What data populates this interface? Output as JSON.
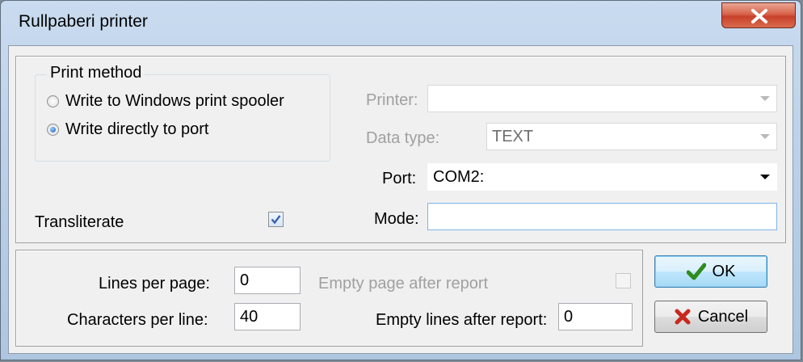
{
  "window": {
    "title": "Rullpaberi printer"
  },
  "print_method": {
    "legend": "Print method",
    "options": [
      {
        "label": "Write to Windows print spooler",
        "checked": false
      },
      {
        "label": "Write directly to port",
        "checked": true
      }
    ]
  },
  "printer": {
    "label": "Printer:",
    "value": ""
  },
  "data_type": {
    "label": "Data type:",
    "value": "TEXT"
  },
  "port": {
    "label": "Port:",
    "value": "COM2:"
  },
  "mode": {
    "label": "Mode:",
    "value": ""
  },
  "transliterate": {
    "label": "Transliterate",
    "checked": true
  },
  "lines_per_page": {
    "label": "Lines per page:",
    "value": "0"
  },
  "chars_per_line": {
    "label": "Characters per line:",
    "value": "40"
  },
  "empty_page_after_report": {
    "label": "Empty page after report",
    "checked": false
  },
  "empty_lines_after_report": {
    "label": "Empty lines after report:",
    "value": "0"
  },
  "buttons": {
    "ok": "OK",
    "cancel": "Cancel"
  },
  "colors": {
    "ok_check": "#2e8b1e",
    "cancel_x": "#c8281e",
    "disabled_text": "#a0a0a0"
  }
}
